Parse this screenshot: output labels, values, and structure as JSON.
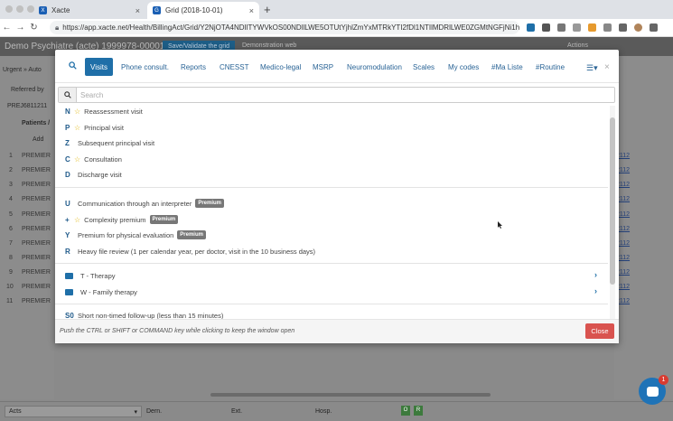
{
  "browser": {
    "tabs": [
      {
        "title": "Xacte",
        "favicon": "X"
      },
      {
        "title": "Grid (2018-10-01)",
        "favicon": "G"
      }
    ],
    "url": "https://app.xacte.net/Health/BillingAct/Grid/Y2NjOTA4NDIlTYWVkOS00NDllLWE5OTUtYjhlZmYxMTRkYTI2fDl1NTIlMDRlLWE0ZGMtNGFjNi1hMGF..."
  },
  "app": {
    "title": "Demo Psychiatre (acte) 1999978-00001",
    "save_button": "Save/Validate the grid",
    "demo_web": "Demonstration web",
    "actions": "Actions",
    "left": {
      "urgent": "Urgent » Auto",
      "referred": "Referred by",
      "prej": "PREJ6811211",
      "patients_header": "Patients /",
      "add": "Add",
      "rows": [
        {
          "num": "1",
          "name": "PREMIER"
        },
        {
          "num": "2",
          "name": "PREMIER"
        },
        {
          "num": "3",
          "name": "PREMIER"
        },
        {
          "num": "4",
          "name": "PREMIER"
        },
        {
          "num": "5",
          "name": "PREMIER"
        },
        {
          "num": "6",
          "name": "PREMIER"
        },
        {
          "num": "7",
          "name": "PREMIER"
        },
        {
          "num": "8",
          "name": "PREMIER"
        },
        {
          "num": "9",
          "name": "PREMIER"
        },
        {
          "num": "10",
          "name": "PREMIER"
        },
        {
          "num": "11",
          "name": "PREMIER"
        }
      ]
    },
    "right_values": [
      "2112",
      "2112",
      "2112",
      "2112",
      "2112",
      "2112",
      "2112",
      "2112",
      "2112",
      "2112",
      "2112"
    ],
    "footer": {
      "acts": "Acts",
      "dern": "Dern.",
      "ext": "Ext.",
      "hosp": "Hosp.",
      "o": "O",
      "r": "R"
    },
    "chat_badge": "1"
  },
  "modal": {
    "tabs": [
      "Visits",
      "Phone consult.",
      "Reports",
      "CNESST",
      "Medico-legal",
      "MSRP",
      "Neuromodulation",
      "Scales",
      "My codes",
      "#Ma Liste",
      "#Routine"
    ],
    "active_tab": "Visits",
    "search_placeholder": "Search",
    "items_group1": [
      {
        "code": "N",
        "star": true,
        "label": "Reassessment visit"
      },
      {
        "code": "P",
        "star": true,
        "label": "Principal visit"
      },
      {
        "code": "Z",
        "star": false,
        "label": "Subsequent principal visit"
      },
      {
        "code": "C",
        "star": true,
        "label": "Consultation"
      },
      {
        "code": "D",
        "star": false,
        "label": "Discharge visit"
      }
    ],
    "items_group2": [
      {
        "code": "U",
        "star": false,
        "label": "Communication through an interpreter",
        "badge": "Premium"
      },
      {
        "code": "+",
        "star": true,
        "label": "Complexity premium",
        "badge": "Premium"
      },
      {
        "code": "Y",
        "star": false,
        "label": "Premium for physical evaluation",
        "badge": "Premium"
      },
      {
        "code": "R",
        "star": false,
        "label": "Heavy file review (1 per calendar year, per doctor, visit in the 10 business days)",
        "badge": ""
      }
    ],
    "folders": [
      {
        "label": "T - Therapy"
      },
      {
        "label": "W - Family therapy"
      }
    ],
    "items_group3": [
      {
        "code": "S0",
        "label": "Short non-timed follow-up (less than 15 minutes)"
      }
    ],
    "hint": "Push the CTRL or SHIFT or COMMAND key while clicking to keep the window open",
    "close_label": "Close"
  }
}
